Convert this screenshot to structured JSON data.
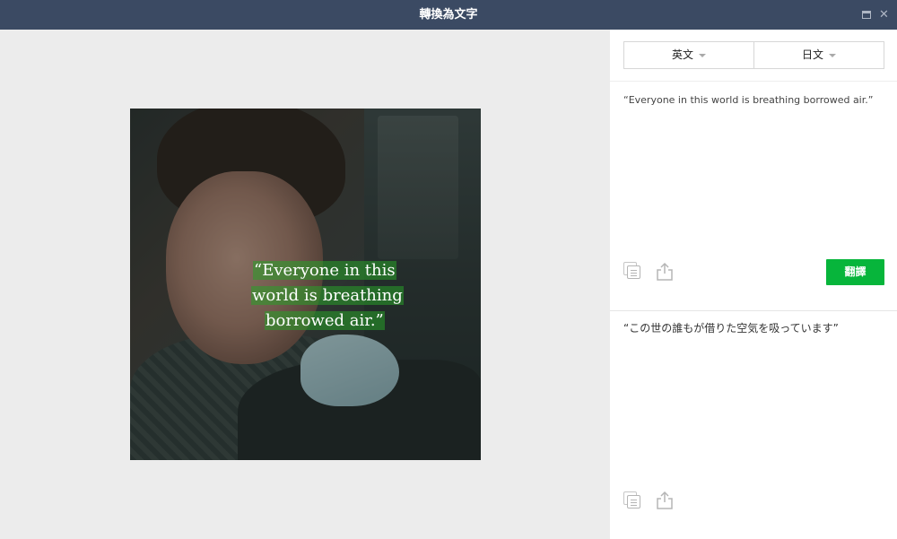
{
  "window": {
    "title": "轉換為文字"
  },
  "image_panel": {
    "overlay_quote": {
      "line1": "“Everyone in this",
      "line2": "world is breathing",
      "line3": "borrowed air.”"
    },
    "highlight_color": "#28a028"
  },
  "translator": {
    "source_lang": "英文",
    "target_lang": "日文",
    "source_text": "“Everyone in this world is breathing borrowed air.”",
    "translate_label": "翻譯",
    "result_text": "“この世の誰もが借りた空気を吸っています”"
  },
  "colors": {
    "titlebar": "#3b4a63",
    "accent": "#07b53b",
    "left_pane_bg": "#ececec"
  },
  "icons": {
    "copy": "copy-icon",
    "share": "share-icon",
    "minimize": "window-icon",
    "close": "close-icon"
  }
}
